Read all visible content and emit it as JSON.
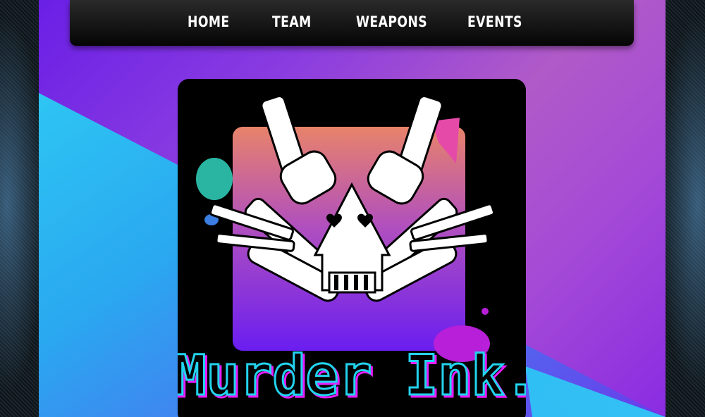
{
  "nav": {
    "items": [
      {
        "label": "HOME"
      },
      {
        "label": "TEAM"
      },
      {
        "label": "WEAPONS"
      },
      {
        "label": "EVENTS"
      }
    ]
  },
  "logo": {
    "wordmark": "Murder Ink.",
    "colors": {
      "wordmark_fill": "#000000",
      "wordmark_outline_cyan": "#22d3ee",
      "wordmark_outline_magenta": "#e81cff",
      "square_top": "#e8836a",
      "square_bottom": "#6a1ef0"
    }
  },
  "theme": {
    "purple": "#8a3ce0",
    "cyan": "#2fd0f4",
    "nav_bg": "#111111"
  }
}
